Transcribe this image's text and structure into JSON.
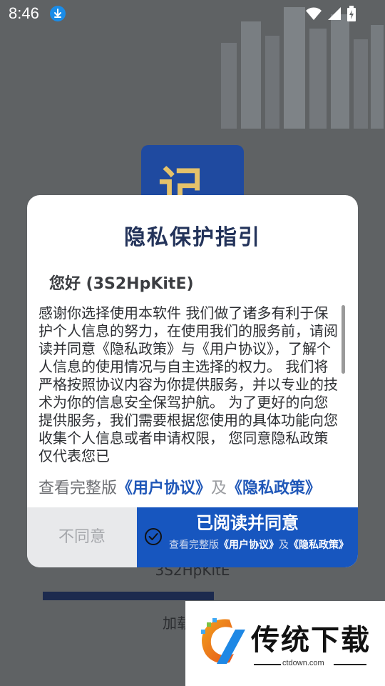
{
  "status_bar": {
    "time": "8:46",
    "icons": [
      "download-icon",
      "wifi-icon",
      "signal-icon",
      "battery-charging-icon"
    ]
  },
  "background_app": {
    "logo_text": "记",
    "account_id": "3S2HpKitE",
    "loading_text": "加载"
  },
  "dialog": {
    "title": "隐私保护指引",
    "greeting": "您好 (3S2HpKitE)",
    "body": "感谢你选择使用本软件 我们做了诸多有利于保护个人信息的努力，在使用我们的服务前，请阅读并同意《隐私政策》与《用户协议》，了解个人信息的使用情况与自主选择的权力。 我们将严格按照协议内容为你提供服务，并以专业的技术为你的信息安全保驾护航。 为了更好的向您提供服务，我们需要根据您使用的具体功能向您收集个人信息或者申请权限， 您同意隐私政策仅代表您已",
    "links_line": {
      "prefix": "查看完整版",
      "user_agreement": "《用户协议》",
      "conjunction": "及",
      "privacy_policy": "《隐私政策》"
    },
    "disagree_button": "不同意",
    "agree_button": {
      "label": "已阅读并同意",
      "sub_prefix": "查看完整版",
      "sub_user_agreement": "《用户协议》",
      "sub_conjunction": "及",
      "sub_privacy_policy": "《隐私政策》"
    }
  },
  "watermark": {
    "title": "传统下载",
    "domain": "ctdown.com"
  },
  "colors": {
    "dim_overlay": "#5f6264",
    "dialog_title": "#23335a",
    "link_blue": "#1f57b8",
    "agree_button_bg": "#1756bf",
    "disagree_button_bg": "#e8e9eb"
  }
}
